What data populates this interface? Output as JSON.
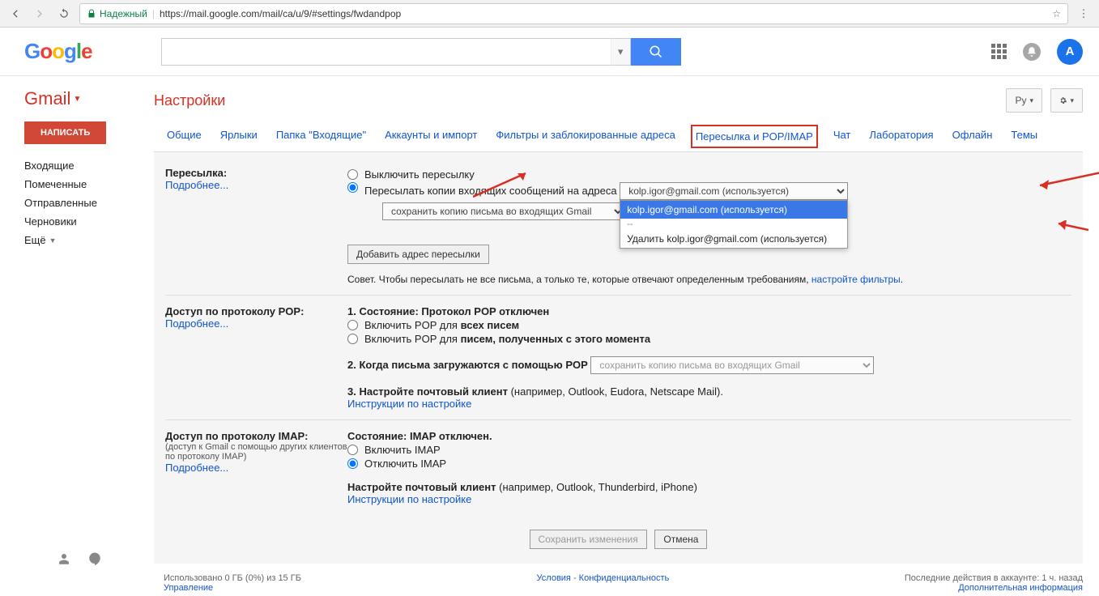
{
  "browser": {
    "secure_label": "Надежный",
    "url": "https://mail.google.com/mail/ca/u/9/#settings/fwdandpop"
  },
  "header": {
    "logo_letters": [
      "G",
      "o",
      "o",
      "g",
      "l",
      "e"
    ],
    "avatar_letter": "А"
  },
  "sidebar": {
    "gmail": "Gmail",
    "compose": "НАПИСАТЬ",
    "items": [
      "Входящие",
      "Помеченные",
      "Отправленные",
      "Черновики",
      "Ещё"
    ]
  },
  "page": {
    "title": "Настройки",
    "lang_btn": "Ру"
  },
  "tabs": [
    "Общие",
    "Ярлыки",
    "Папка \"Входящие\"",
    "Аккаунты и импорт",
    "Фильтры и заблокированные адреса",
    "Пересылка и POP/IMAP",
    "Чат",
    "Лаборатория",
    "Офлайн",
    "Темы"
  ],
  "active_tab_index": 5,
  "forwarding": {
    "row_label": "Пересылка:",
    "learn_more": "Подробнее...",
    "disable": "Выключить пересылку",
    "copy_prefix": "Пересылать копии входящих сообщений на адреса",
    "address_selected": "kolp.igor@gmail.com (используется)",
    "keep_copy": "сохранить копию письма во входящих Gmail",
    "add_btn": "Добавить адрес пересылки",
    "tip_prefix": "Совет. Чтобы пересылать не все письма, а только те, которые отвечают определенным требованиям, ",
    "tip_link": "настройте фильтры",
    "dropdown": {
      "sel": "kolp.igor@gmail.com (используется)",
      "sep": "--",
      "del": "Удалить kolp.igor@gmail.com (используется)"
    }
  },
  "pop": {
    "row_label": "Доступ по протоколу POP:",
    "learn_more": "Подробнее...",
    "status_label": "1. Состояние: ",
    "status_value": "Протокол POP отключен",
    "enable_all": "Включить POP для ",
    "enable_all_b": "всех писем",
    "enable_now": "Включить POP для ",
    "enable_now_b": "писем, полученных с этого момента",
    "when_dl": "2. Когда письма загружаются с помощью POP",
    "when_dl_select": "сохранить копию письма во входящих Gmail",
    "client_lbl": "3. Настройте почтовый клиент ",
    "client_ex": "(например, Outlook, Eudora, Netscape Mail).",
    "instr": "Инструкции по настройке"
  },
  "imap": {
    "row_label": "Доступ по протоколу IMAP:",
    "sub": "(доступ к Gmail с помощью других клиентов по протоколу IMAP)",
    "learn_more": "Подробнее...",
    "status_label": "Состояние: ",
    "status_value": "IMAP отключен.",
    "enable": "Включить IMAP",
    "disable": "Отключить IMAP",
    "client_lbl": "Настройте почтовый клиент ",
    "client_ex": "(например, Outlook, Thunderbird, iPhone)",
    "instr": "Инструкции по настройке"
  },
  "footer": {
    "save": "Сохранить изменения",
    "cancel": "Отмена",
    "storage": "Использовано 0 ГБ (0%) из 15 ГБ",
    "manage": "Управление",
    "terms": "Условия",
    "dash": " - ",
    "privacy": "Конфиденциальность",
    "activity": "Последние действия в аккаунте: 1 ч. назад",
    "more_info": "Дополнительная информация"
  }
}
